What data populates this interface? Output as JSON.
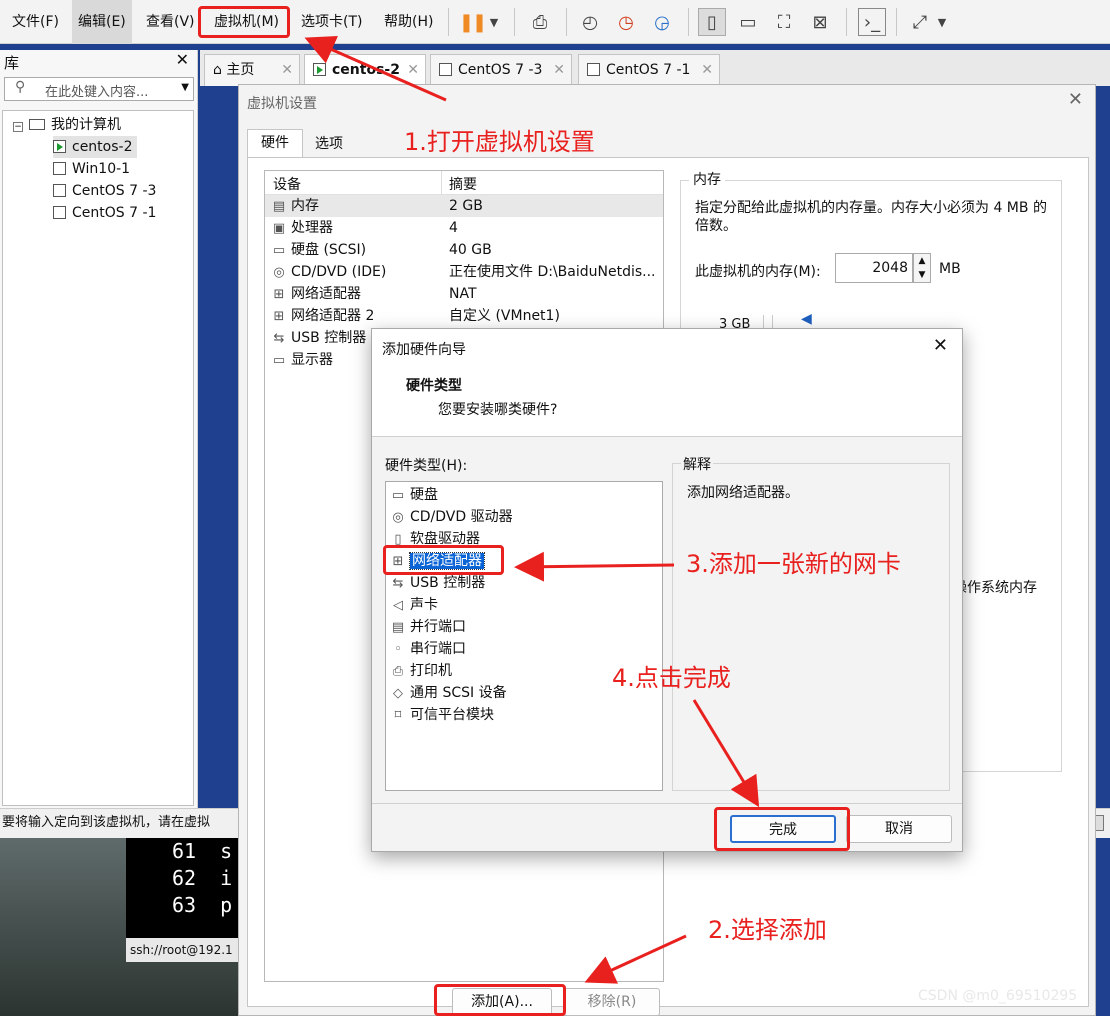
{
  "menubar": {
    "items": [
      "文件(F)",
      "编辑(E)",
      "查看(V)",
      "虚拟机(M)",
      "选项卡(T)",
      "帮助(H)"
    ]
  },
  "library": {
    "title": "库",
    "search_placeholder": "在此处键入内容...",
    "tree": [
      "我的计算机",
      "centos-2",
      "Win10-1",
      "CentOS 7 -3",
      "CentOS 7 -1"
    ]
  },
  "tabs": [
    "主页",
    "centos-2",
    "CentOS 7 -3",
    "CentOS 7 -1"
  ],
  "statusbar": {
    "text": "要将输入定向到该虚拟机，请在虚拟"
  },
  "terminal": {
    "lines": [
      "61  s",
      "62  i",
      "63  p"
    ],
    "ssh": "ssh://root@192.1"
  },
  "settings": {
    "title": "虚拟机设置",
    "tabs": [
      "硬件",
      "选项"
    ],
    "col_device": "设备",
    "col_summary": "摘要",
    "devices": [
      {
        "icon": "memory-icon",
        "name": "内存",
        "summary": "2 GB"
      },
      {
        "icon": "cpu-icon",
        "name": "处理器",
        "summary": "4"
      },
      {
        "icon": "disk-icon",
        "name": "硬盘 (SCSI)",
        "summary": "40 GB"
      },
      {
        "icon": "cd-icon",
        "name": "CD/DVD (IDE)",
        "summary": "正在使用文件 D:\\BaiduNetdis..."
      },
      {
        "icon": "network-icon",
        "name": "网络适配器",
        "summary": "NAT"
      },
      {
        "icon": "network-icon",
        "name": "网络适配器 2",
        "summary": "自定义 (VMnet1)"
      },
      {
        "icon": "usb-icon",
        "name": "USB 控制器",
        "summary": ""
      },
      {
        "icon": "display-icon",
        "name": "显示器",
        "summary": ""
      }
    ],
    "memory_group": "内存",
    "memory_desc": "指定分配给此虚拟机的内存量。内存大小必须为 4 MB 的倍数。",
    "memory_label": "此虚拟机的内存(M):",
    "memory_value": "2048",
    "memory_unit": "MB",
    "scale_label": "3 GB",
    "partial_1": "机操作系统内存",
    "partial_2": "。",
    "add_button": "添加(A)...",
    "remove_button": "移除(R)"
  },
  "wizard": {
    "title": "添加硬件向导",
    "heading": "硬件类型",
    "subheading": "您要安装哪类硬件?",
    "list_label": "硬件类型(H):",
    "items": [
      {
        "icon": "disk-icon",
        "label": "硬盘"
      },
      {
        "icon": "cd-icon",
        "label": "CD/DVD 驱动器"
      },
      {
        "icon": "floppy-icon",
        "label": "软盘驱动器"
      },
      {
        "icon": "network-icon",
        "label": "网络适配器"
      },
      {
        "icon": "usb-icon",
        "label": "USB 控制器"
      },
      {
        "icon": "sound-icon",
        "label": "声卡"
      },
      {
        "icon": "parallel-port-icon",
        "label": "并行端口"
      },
      {
        "icon": "serial-port-icon",
        "label": "串行端口"
      },
      {
        "icon": "printer-icon",
        "label": "打印机"
      },
      {
        "icon": "scsi-icon",
        "label": "通用 SCSI 设备"
      },
      {
        "icon": "tpm-icon",
        "label": "可信平台模块"
      }
    ],
    "selected_index": 3,
    "explain_title": "解释",
    "explain_text": "添加网络适配器。",
    "finish_button": "完成",
    "cancel_button": "取消"
  },
  "annotations": {
    "step1": "1.打开虚拟机设置",
    "step2": "2.选择添加",
    "step3": "3.添加一张新的网卡",
    "step4": "4.点击完成",
    "color": "#e8211f"
  },
  "watermark": "CSDN @m0_69510295"
}
